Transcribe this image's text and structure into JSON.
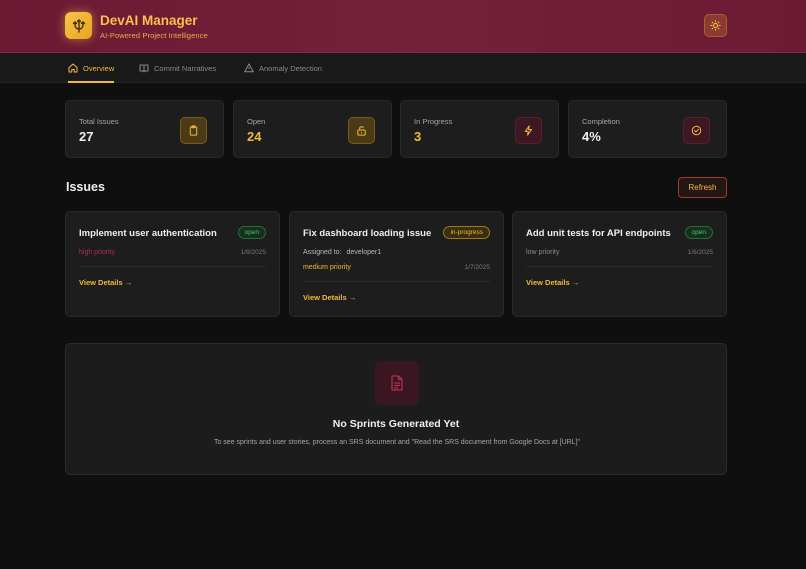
{
  "header": {
    "title": "DevAI Manager",
    "subtitle": "AI-Powered Project Intelligence",
    "logo_icon": "trident-icon",
    "theme_icon": "sun-icon"
  },
  "tabs": [
    {
      "label": "Overview",
      "icon": "home-icon",
      "active": true
    },
    {
      "label": "Commit Narratives",
      "icon": "book-icon",
      "active": false
    },
    {
      "label": "Anomaly Detection",
      "icon": "warning-triangle-icon",
      "active": false
    }
  ],
  "stats": [
    {
      "label": "Total Issues",
      "value": "27",
      "color": "#f1efec",
      "icon": "clipboard-icon"
    },
    {
      "label": "Open",
      "value": "24",
      "color": "#f2b93b",
      "icon": "unlock-icon"
    },
    {
      "label": "In Progress",
      "value": "3",
      "color": "#f2b93b",
      "icon": "lightning-icon"
    },
    {
      "label": "Completion",
      "value": "4%",
      "color": "#f1efec",
      "icon": "check-circle-icon"
    }
  ],
  "issues_section": {
    "title": "Issues",
    "refresh_label": "Refresh"
  },
  "issues": [
    {
      "title": "Implement user authentication",
      "status": "open",
      "priority": "high priority",
      "priority_color": "#b0304a",
      "date": "1/8/2025",
      "view_label": "View Details →"
    },
    {
      "title": "Fix dashboard loading issue",
      "status": "in-progress",
      "assigned_label": "Assigned to:",
      "assignee": "developer1",
      "priority": "medium priority",
      "priority_color": "#f2b93b",
      "date": "1/7/2025",
      "view_label": "View Details →"
    },
    {
      "title": "Add unit tests for API endpoints",
      "status": "open",
      "priority": "low priority",
      "priority_color": "#8d8a86",
      "date": "1/6/2025",
      "view_label": "View Details →"
    }
  ],
  "empty_state": {
    "icon": "document-icon",
    "title": "No Sprints Generated Yet",
    "description": "To see sprints and user stories, process an SRS document and \"Read the SRS document from Google Docs at [URL]\""
  }
}
